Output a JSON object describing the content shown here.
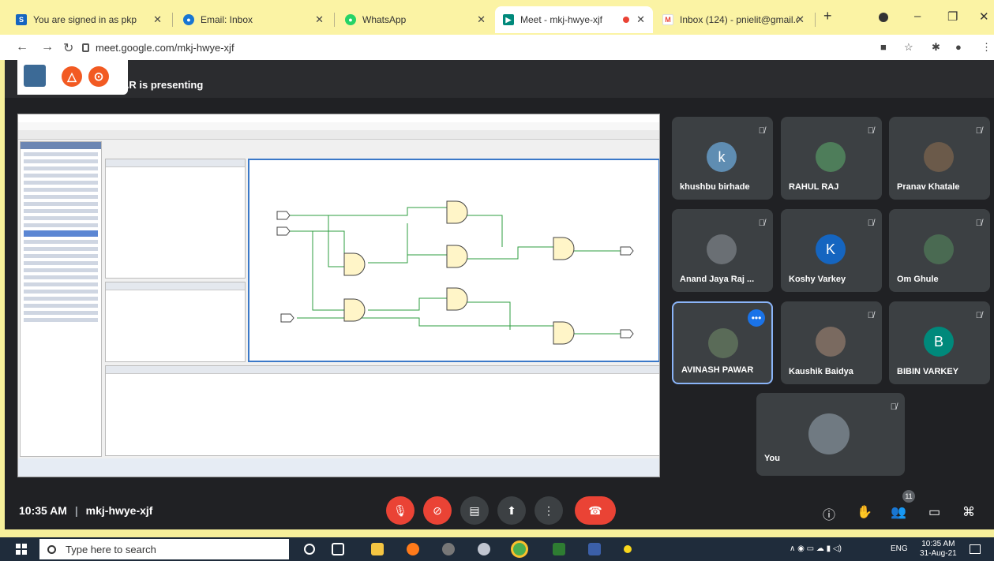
{
  "browser": {
    "tabs": [
      {
        "title": "You are signed in as pkp",
        "favicon": "S",
        "color": "#1565c0"
      },
      {
        "title": "Email: Inbox",
        "favicon": "●",
        "color": "#1976d2"
      },
      {
        "title": "WhatsApp",
        "favicon": "●",
        "color": "#25d366"
      },
      {
        "title": "Meet - mkj-hwye-xjf",
        "favicon": "▶",
        "color": "#00897b"
      },
      {
        "title": "Inbox (124) - pnielit@gmail.c",
        "favicon": "M",
        "color": "#ea4335"
      }
    ],
    "new_tab": "+",
    "url": "meet.google.com/mkj-hwye-xjf"
  },
  "meet": {
    "presenting_text": "AR is presenting",
    "meeting_time": "10:35 AM",
    "meeting_code": "mkj-hwye-xjf",
    "people_count": "11",
    "participants": [
      {
        "name": "khushbu birhade",
        "initial": "k",
        "color": "#5f8db2"
      },
      {
        "name": "RAHUL RAJ",
        "initial": "",
        "color": "#4e7d5a"
      },
      {
        "name": "Pranav Khatale",
        "initial": "",
        "color": "#6b5a4a"
      },
      {
        "name": "Anand Jaya Raj ...",
        "initial": "",
        "color": "#6a6f74"
      },
      {
        "name": "Koshy Varkey",
        "initial": "K",
        "color": "#1565c0"
      },
      {
        "name": "Om Ghule",
        "initial": "",
        "color": "#4a6a52"
      },
      {
        "name": "AVINASH PAWAR",
        "initial": "",
        "color": "#5a6b58"
      },
      {
        "name": "Kaushik Baidya",
        "initial": "",
        "color": "#7a6a60"
      },
      {
        "name": "BIBIN VARKEY",
        "initial": "B",
        "color": "#00897b"
      },
      {
        "name": "You",
        "initial": "",
        "color": "#707a82"
      }
    ]
  },
  "taskbar": {
    "search_placeholder": "Type here to search",
    "lang": "ENG",
    "time": "10:35 AM",
    "date": "31-Aug-21"
  }
}
